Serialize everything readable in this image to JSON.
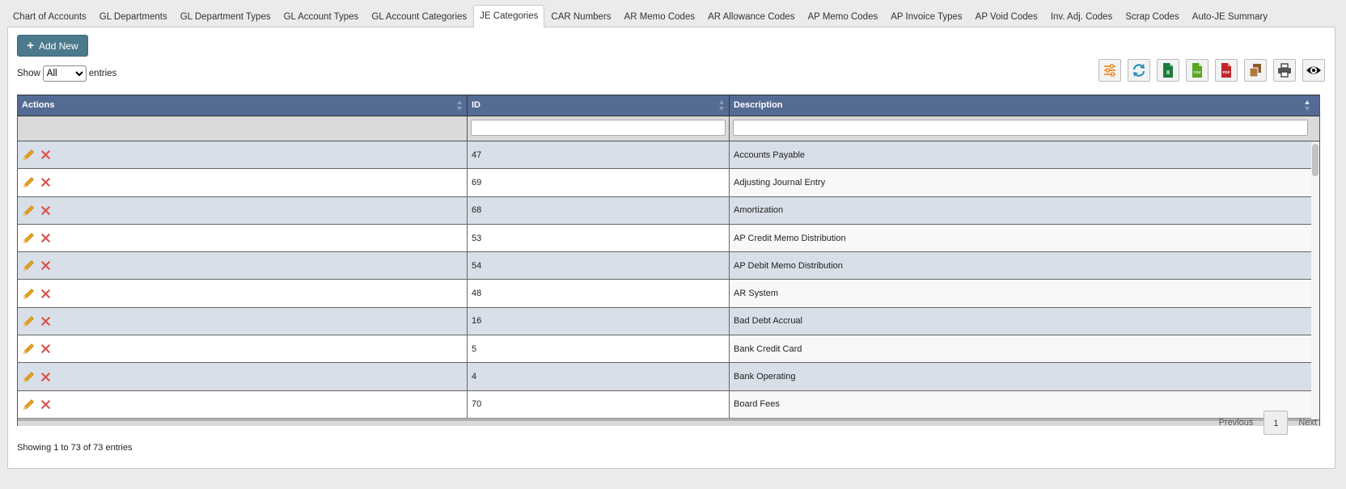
{
  "tabs": [
    {
      "label": "Chart of Accounts",
      "active": false
    },
    {
      "label": "GL Departments",
      "active": false
    },
    {
      "label": "GL Department Types",
      "active": false
    },
    {
      "label": "GL Account Types",
      "active": false
    },
    {
      "label": "GL Account Categories",
      "active": false
    },
    {
      "label": "JE Categories",
      "active": true
    },
    {
      "label": "CAR Numbers",
      "active": false
    },
    {
      "label": "AR Memo Codes",
      "active": false
    },
    {
      "label": "AR Allowance Codes",
      "active": false
    },
    {
      "label": "AP Memo Codes",
      "active": false
    },
    {
      "label": "AP Invoice Types",
      "active": false
    },
    {
      "label": "AP Void Codes",
      "active": false
    },
    {
      "label": "Inv. Adj. Codes",
      "active": false
    },
    {
      "label": "Scrap Codes",
      "active": false
    },
    {
      "label": "Auto-JE Summary",
      "active": false
    }
  ],
  "toolbar": {
    "add_label": "Add New",
    "show_label": "Show",
    "entries_label": "entries",
    "page_length": "All",
    "tools": [
      "column-settings-icon",
      "refresh-icon",
      "excel-icon",
      "csv-icon",
      "pdf-icon",
      "copy-icon",
      "print-icon",
      "view-icon"
    ]
  },
  "table": {
    "columns": [
      "Actions",
      "ID",
      "Description"
    ],
    "sorted_column": "Description",
    "rows": [
      {
        "id": "47",
        "description": "Accounts Payable"
      },
      {
        "id": "69",
        "description": "Adjusting Journal Entry"
      },
      {
        "id": "68",
        "description": "Amortization"
      },
      {
        "id": "53",
        "description": "AP Credit Memo Distribution"
      },
      {
        "id": "54",
        "description": "AP Debit Memo Distribution"
      },
      {
        "id": "48",
        "description": "AR System"
      },
      {
        "id": "16",
        "description": "Bad Debt Accrual"
      },
      {
        "id": "5",
        "description": "Bank Credit Card"
      },
      {
        "id": "4",
        "description": "Bank Operating"
      },
      {
        "id": "70",
        "description": "Board Fees"
      }
    ]
  },
  "footer": {
    "info": "Showing 1 to 73 of 73 entries",
    "previous": "Previous",
    "page": "1",
    "next": "Next"
  },
  "colors": {
    "header": "#546b93",
    "add_button": "#4c7a8d",
    "edit_icon": "#e8a317",
    "delete_icon": "#d9534f"
  }
}
